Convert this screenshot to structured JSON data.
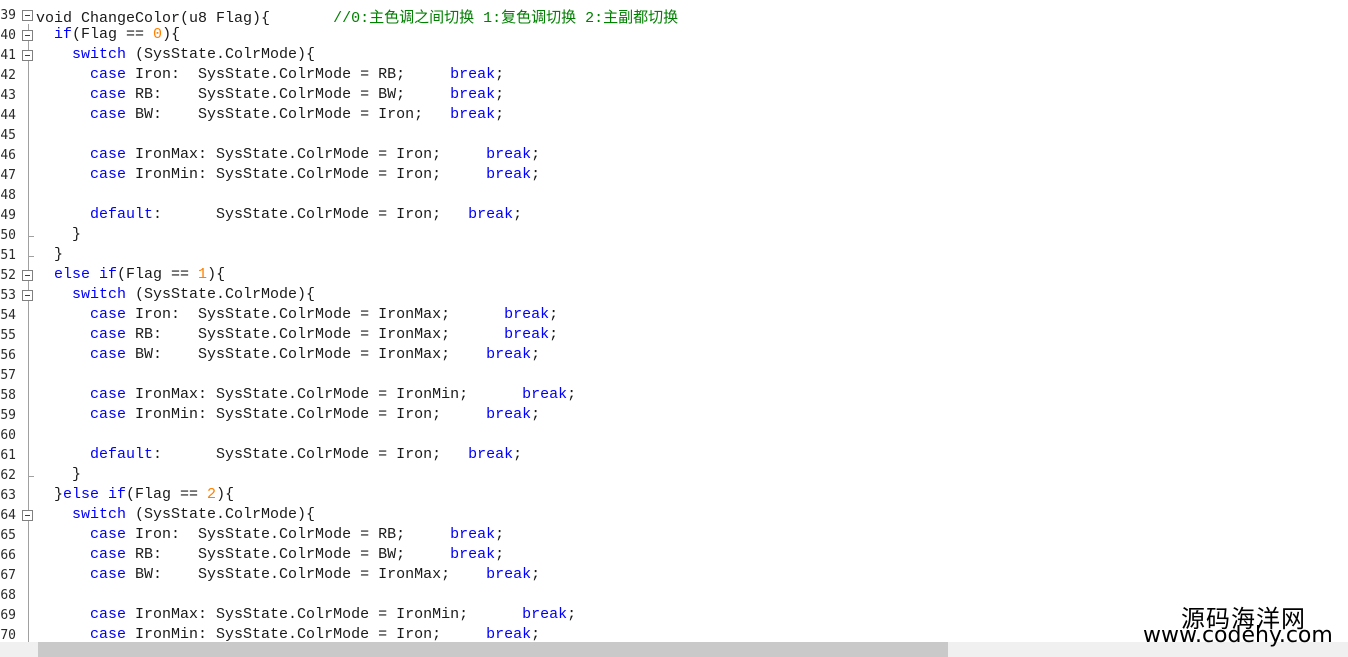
{
  "line_numbers": [
    "39",
    "40",
    "41",
    "42",
    "43",
    "44",
    "45",
    "46",
    "47",
    "48",
    "49",
    "50",
    "51",
    "52",
    "53",
    "54",
    "55",
    "56",
    "57",
    "58",
    "59",
    "60",
    "61",
    "62",
    "63",
    "64",
    "65",
    "66",
    "67",
    "68",
    "69",
    "70"
  ],
  "code_lines": [
    [
      {
        "t": "void ChangeColor(u8 Flag){       "
      },
      {
        "c": "cm",
        "t": "//0:主色调之间切换 1:复色调切换 2:主副都切换"
      }
    ],
    [
      {
        "t": "  "
      },
      {
        "c": "kw",
        "t": "if"
      },
      {
        "t": "(Flag == "
      },
      {
        "c": "num",
        "t": "0"
      },
      {
        "t": "){"
      }
    ],
    [
      {
        "t": "    "
      },
      {
        "c": "kw",
        "t": "switch"
      },
      {
        "t": " (SysState.ColrMode){"
      }
    ],
    [
      {
        "t": "      "
      },
      {
        "c": "kw",
        "t": "case"
      },
      {
        "t": " Iron:  SysState.ColrMode = RB;     "
      },
      {
        "c": "kw",
        "t": "break"
      },
      {
        "t": ";"
      }
    ],
    [
      {
        "t": "      "
      },
      {
        "c": "kw",
        "t": "case"
      },
      {
        "t": " RB:    SysState.ColrMode = BW;     "
      },
      {
        "c": "kw",
        "t": "break"
      },
      {
        "t": ";"
      }
    ],
    [
      {
        "t": "      "
      },
      {
        "c": "kw",
        "t": "case"
      },
      {
        "t": " BW:    SysState.ColrMode = Iron;   "
      },
      {
        "c": "kw",
        "t": "break"
      },
      {
        "t": ";"
      }
    ],
    [],
    [
      {
        "t": "      "
      },
      {
        "c": "kw",
        "t": "case"
      },
      {
        "t": " IronMax: SysState.ColrMode = Iron;     "
      },
      {
        "c": "kw",
        "t": "break"
      },
      {
        "t": ";"
      }
    ],
    [
      {
        "t": "      "
      },
      {
        "c": "kw",
        "t": "case"
      },
      {
        "t": " IronMin: SysState.ColrMode = Iron;     "
      },
      {
        "c": "kw",
        "t": "break"
      },
      {
        "t": ";"
      }
    ],
    [],
    [
      {
        "t": "      "
      },
      {
        "c": "kw",
        "t": "default"
      },
      {
        "t": ":      SysState.ColrMode = Iron;   "
      },
      {
        "c": "kw",
        "t": "break"
      },
      {
        "t": ";"
      }
    ],
    [
      {
        "t": "    }"
      }
    ],
    [
      {
        "t": "  }"
      }
    ],
    [
      {
        "t": "  "
      },
      {
        "c": "kw",
        "t": "else if"
      },
      {
        "t": "(Flag == "
      },
      {
        "c": "num",
        "t": "1"
      },
      {
        "t": "){"
      }
    ],
    [
      {
        "t": "    "
      },
      {
        "c": "kw",
        "t": "switch"
      },
      {
        "t": " (SysState.ColrMode){"
      }
    ],
    [
      {
        "t": "      "
      },
      {
        "c": "kw",
        "t": "case"
      },
      {
        "t": " Iron:  SysState.ColrMode = IronMax;      "
      },
      {
        "c": "kw",
        "t": "break"
      },
      {
        "t": ";"
      }
    ],
    [
      {
        "t": "      "
      },
      {
        "c": "kw",
        "t": "case"
      },
      {
        "t": " RB:    SysState.ColrMode = IronMax;      "
      },
      {
        "c": "kw",
        "t": "break"
      },
      {
        "t": ";"
      }
    ],
    [
      {
        "t": "      "
      },
      {
        "c": "kw",
        "t": "case"
      },
      {
        "t": " BW:    SysState.ColrMode = IronMax;    "
      },
      {
        "c": "kw",
        "t": "break"
      },
      {
        "t": ";"
      }
    ],
    [],
    [
      {
        "t": "      "
      },
      {
        "c": "kw",
        "t": "case"
      },
      {
        "t": " IronMax: SysState.ColrMode = IronMin;      "
      },
      {
        "c": "kw",
        "t": "break"
      },
      {
        "t": ";"
      }
    ],
    [
      {
        "t": "      "
      },
      {
        "c": "kw",
        "t": "case"
      },
      {
        "t": " IronMin: SysState.ColrMode = Iron;     "
      },
      {
        "c": "kw",
        "t": "break"
      },
      {
        "t": ";"
      }
    ],
    [],
    [
      {
        "t": "      "
      },
      {
        "c": "kw",
        "t": "default"
      },
      {
        "t": ":      SysState.ColrMode = Iron;   "
      },
      {
        "c": "kw",
        "t": "break"
      },
      {
        "t": ";"
      }
    ],
    [
      {
        "t": "    }"
      }
    ],
    [
      {
        "t": "  }"
      },
      {
        "c": "kw",
        "t": "else if"
      },
      {
        "t": "(Flag == "
      },
      {
        "c": "num",
        "t": "2"
      },
      {
        "t": "){"
      }
    ],
    [
      {
        "t": "    "
      },
      {
        "c": "kw",
        "t": "switch"
      },
      {
        "t": " (SysState.ColrMode){"
      }
    ],
    [
      {
        "t": "      "
      },
      {
        "c": "kw",
        "t": "case"
      },
      {
        "t": " Iron:  SysState.ColrMode = RB;     "
      },
      {
        "c": "kw",
        "t": "break"
      },
      {
        "t": ";"
      }
    ],
    [
      {
        "t": "      "
      },
      {
        "c": "kw",
        "t": "case"
      },
      {
        "t": " RB:    SysState.ColrMode = BW;     "
      },
      {
        "c": "kw",
        "t": "break"
      },
      {
        "t": ";"
      }
    ],
    [
      {
        "t": "      "
      },
      {
        "c": "kw",
        "t": "case"
      },
      {
        "t": " BW:    SysState.ColrMode = IronMax;    "
      },
      {
        "c": "kw",
        "t": "break"
      },
      {
        "t": ";"
      }
    ],
    [],
    [
      {
        "t": "      "
      },
      {
        "c": "kw",
        "t": "case"
      },
      {
        "t": " IronMax: SysState.ColrMode = IronMin;      "
      },
      {
        "c": "kw",
        "t": "break"
      },
      {
        "t": ";"
      }
    ],
    [
      {
        "t": "      "
      },
      {
        "c": "kw",
        "t": "case"
      },
      {
        "t": " IronMin: SysState.ColrMode = Iron;     "
      },
      {
        "c": "kw",
        "t": "break"
      },
      {
        "t": ";"
      }
    ]
  ],
  "fold_markers": {
    "open": [
      0,
      1,
      2,
      13,
      14,
      25
    ],
    "close": [
      11,
      12,
      23
    ]
  },
  "watermark": {
    "line1": "源码海洋网",
    "line2": "www.codehy.com"
  },
  "colors": {
    "keyword": "#0000ff",
    "number": "#ff8000",
    "comment": "#008000",
    "text": "#1a1a1a"
  }
}
